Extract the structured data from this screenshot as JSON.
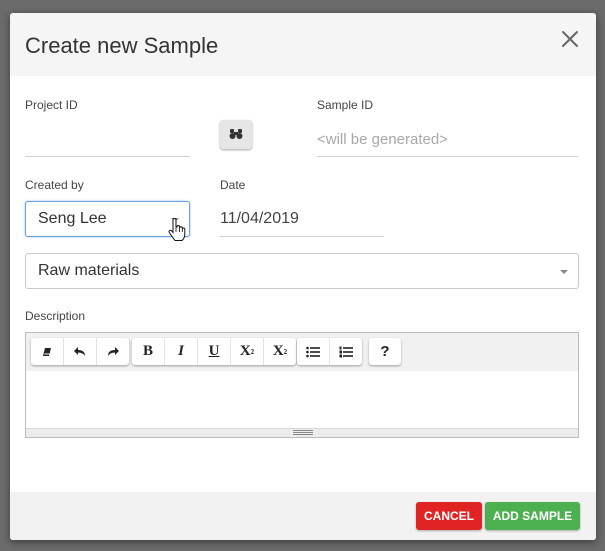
{
  "dialog": {
    "title": "Create new Sample"
  },
  "form": {
    "project_id": {
      "label": "Project ID",
      "value": ""
    },
    "sample_id": {
      "label": "Sample ID",
      "placeholder": "<will be generated>"
    },
    "created_by": {
      "label": "Created by",
      "value": "Seng Lee"
    },
    "date": {
      "label": "Date",
      "value": "11/04/2019"
    },
    "category": {
      "value": "Raw materials"
    },
    "description": {
      "label": "Description",
      "value": ""
    }
  },
  "toolbar": {
    "bold": "B",
    "italic": "I",
    "underline": "U",
    "superscript_base": "X",
    "superscript_mark": "2",
    "subscript_base": "X",
    "subscript_mark": "2",
    "help": "?"
  },
  "footer": {
    "cancel_label": "CANCEL",
    "add_label": "ADD SAMPLE"
  },
  "colors": {
    "cancel": "#e02424",
    "add": "#4caf50",
    "focus": "#6aa0e0"
  }
}
